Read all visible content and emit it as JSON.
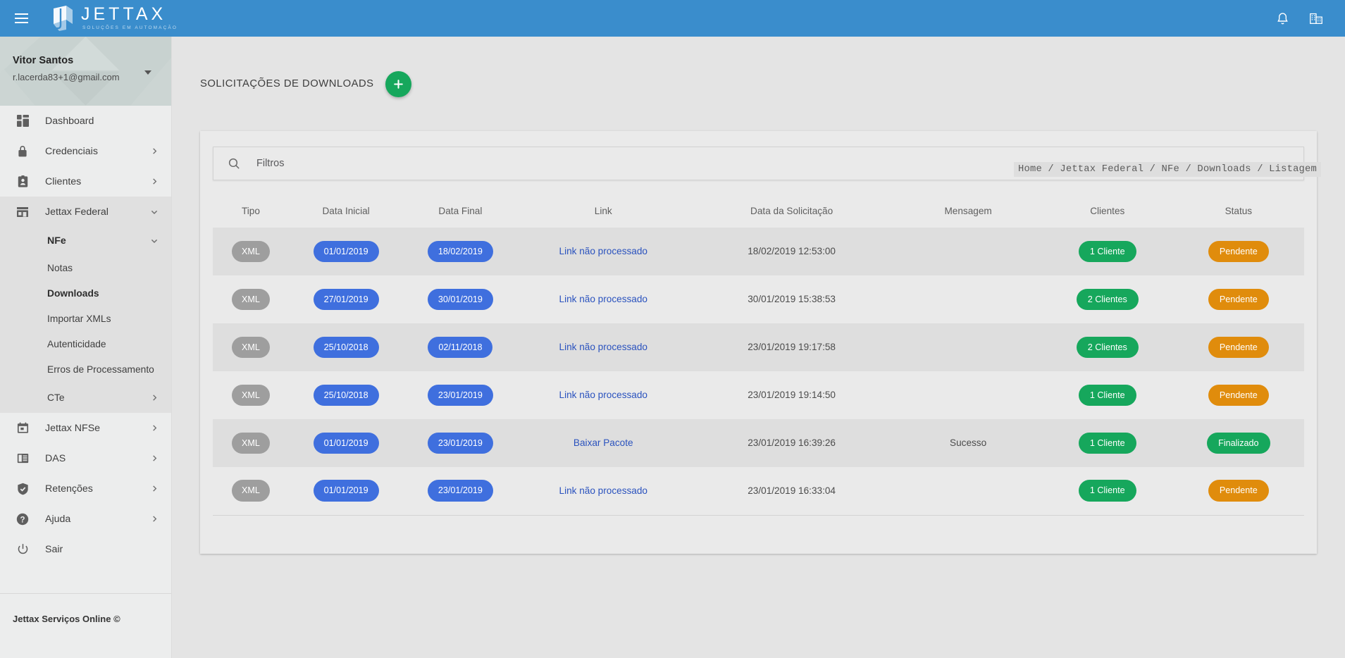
{
  "topbar": {
    "menu_icon": "hamburger-icon",
    "logo_main": "JETTAX",
    "logo_sub": "SOLUÇÕES EM AUTOMAÇÃO",
    "icons": [
      "bell-icon",
      "building-icon"
    ],
    "bg_color": "#3a8dcc"
  },
  "sidebar": {
    "user": {
      "name": "Vitor Santos",
      "email": "r.lacerda83+1@gmail.com",
      "caret": "chevron-down-icon"
    },
    "items": [
      {
        "label": "Dashboard",
        "icon": "dashboard-icon",
        "chevron": ""
      },
      {
        "label": "Credenciais",
        "icon": "lock-icon",
        "chevron": "›"
      },
      {
        "label": "Clientes",
        "icon": "contact-card-icon",
        "chevron": "›"
      },
      {
        "label": "Jettax Federal",
        "icon": "store-icon",
        "chevron": "⌄"
      },
      {
        "label": "Jettax NFSe",
        "icon": "calendar-icon",
        "chevron": "›"
      },
      {
        "label": "DAS",
        "icon": "document-icon",
        "chevron": "›"
      },
      {
        "label": "Retenções",
        "icon": "shield-check-icon",
        "chevron": "›"
      },
      {
        "label": "Ajuda",
        "icon": "help-icon",
        "chevron": "›"
      },
      {
        "label": "Sair",
        "icon": "power-icon",
        "chevron": ""
      }
    ],
    "federal_group": {
      "nfe_label": "NFe",
      "nfe_chevron": "⌄",
      "sub_items": [
        {
          "label": "Notas",
          "active": false
        },
        {
          "label": "Downloads",
          "active": true
        },
        {
          "label": "Importar XMLs",
          "active": false
        },
        {
          "label": "Erros de Processamento",
          "active": false
        }
      ],
      "cte_label": "CTe",
      "cte_chevron": "›"
    },
    "footer": "Jettax Serviços Online ©"
  },
  "page": {
    "title": "SOLICITAÇÕES DE DOWNLOADS",
    "add_button": "+",
    "breadcrumb": "Home / Jettax Federal / NFe / Downloads / Listagem"
  },
  "filter": {
    "icon": "search-icon",
    "placeholder": "Filtros",
    "value": "Filtros"
  },
  "table": {
    "columns": [
      "Tipo",
      "Data Inicial",
      "Data Final",
      "Link",
      "Data da Solicitação",
      "Mensagem",
      "Clientes",
      "Status"
    ],
    "rows": [
      {
        "tipo": "XML",
        "data_inicial": "01/01/2019",
        "data_final": "18/02/2019",
        "link": "Link não processado",
        "data_solicitacao": "18/02/2019 12:53:00",
        "mensagem": "",
        "clientes": "1 Cliente",
        "status": "Pendente",
        "status_color": "#e08c0c"
      },
      {
        "tipo": "XML",
        "data_inicial": "27/01/2019",
        "data_final": "30/01/2019",
        "link": "Link não processado",
        "data_solicitacao": "30/01/2019 15:38:53",
        "mensagem": "",
        "clientes": "2 Clientes",
        "status": "Pendente",
        "status_color": "#e08c0c"
      },
      {
        "tipo": "XML",
        "data_inicial": "25/10/2018",
        "data_final": "02/11/2018",
        "link": "Link não processado",
        "data_solicitacao": "23/01/2019 19:17:58",
        "mensagem": "",
        "clientes": "2 Clientes",
        "status": "Pendente",
        "status_color": "#e08c0c"
      },
      {
        "tipo": "XML",
        "data_inicial": "25/10/2018",
        "data_final": "23/01/2019",
        "link": "Link não processado",
        "data_solicitacao": "23/01/2019 19:14:50",
        "mensagem": "",
        "clientes": "1 Cliente",
        "status": "Pendente",
        "status_color": "#e08c0c"
      },
      {
        "tipo": "XML",
        "data_inicial": "01/01/2019",
        "data_final": "23/01/2019",
        "link": "Baixar Pacote",
        "data_solicitacao": "23/01/2019 16:39:26",
        "mensagem": "Sucesso",
        "clientes": "1 Cliente",
        "status": "Finalizado",
        "status_color": "#16a75c"
      },
      {
        "tipo": "XML",
        "data_inicial": "01/01/2019",
        "data_final": "23/01/2019",
        "link": "Link não processado",
        "data_solicitacao": "23/01/2019 16:33:04",
        "mensagem": "",
        "clientes": "1 Cliente",
        "status": "Pendente",
        "status_color": "#e08c0c"
      }
    ]
  },
  "colors": {
    "brand_blue": "#3a8dcc",
    "link_blue": "#2a52be",
    "date_pill": "#3f6fde",
    "green": "#16a75c",
    "orange": "#e08c0c",
    "gray_pill": "#9e9e9e"
  }
}
